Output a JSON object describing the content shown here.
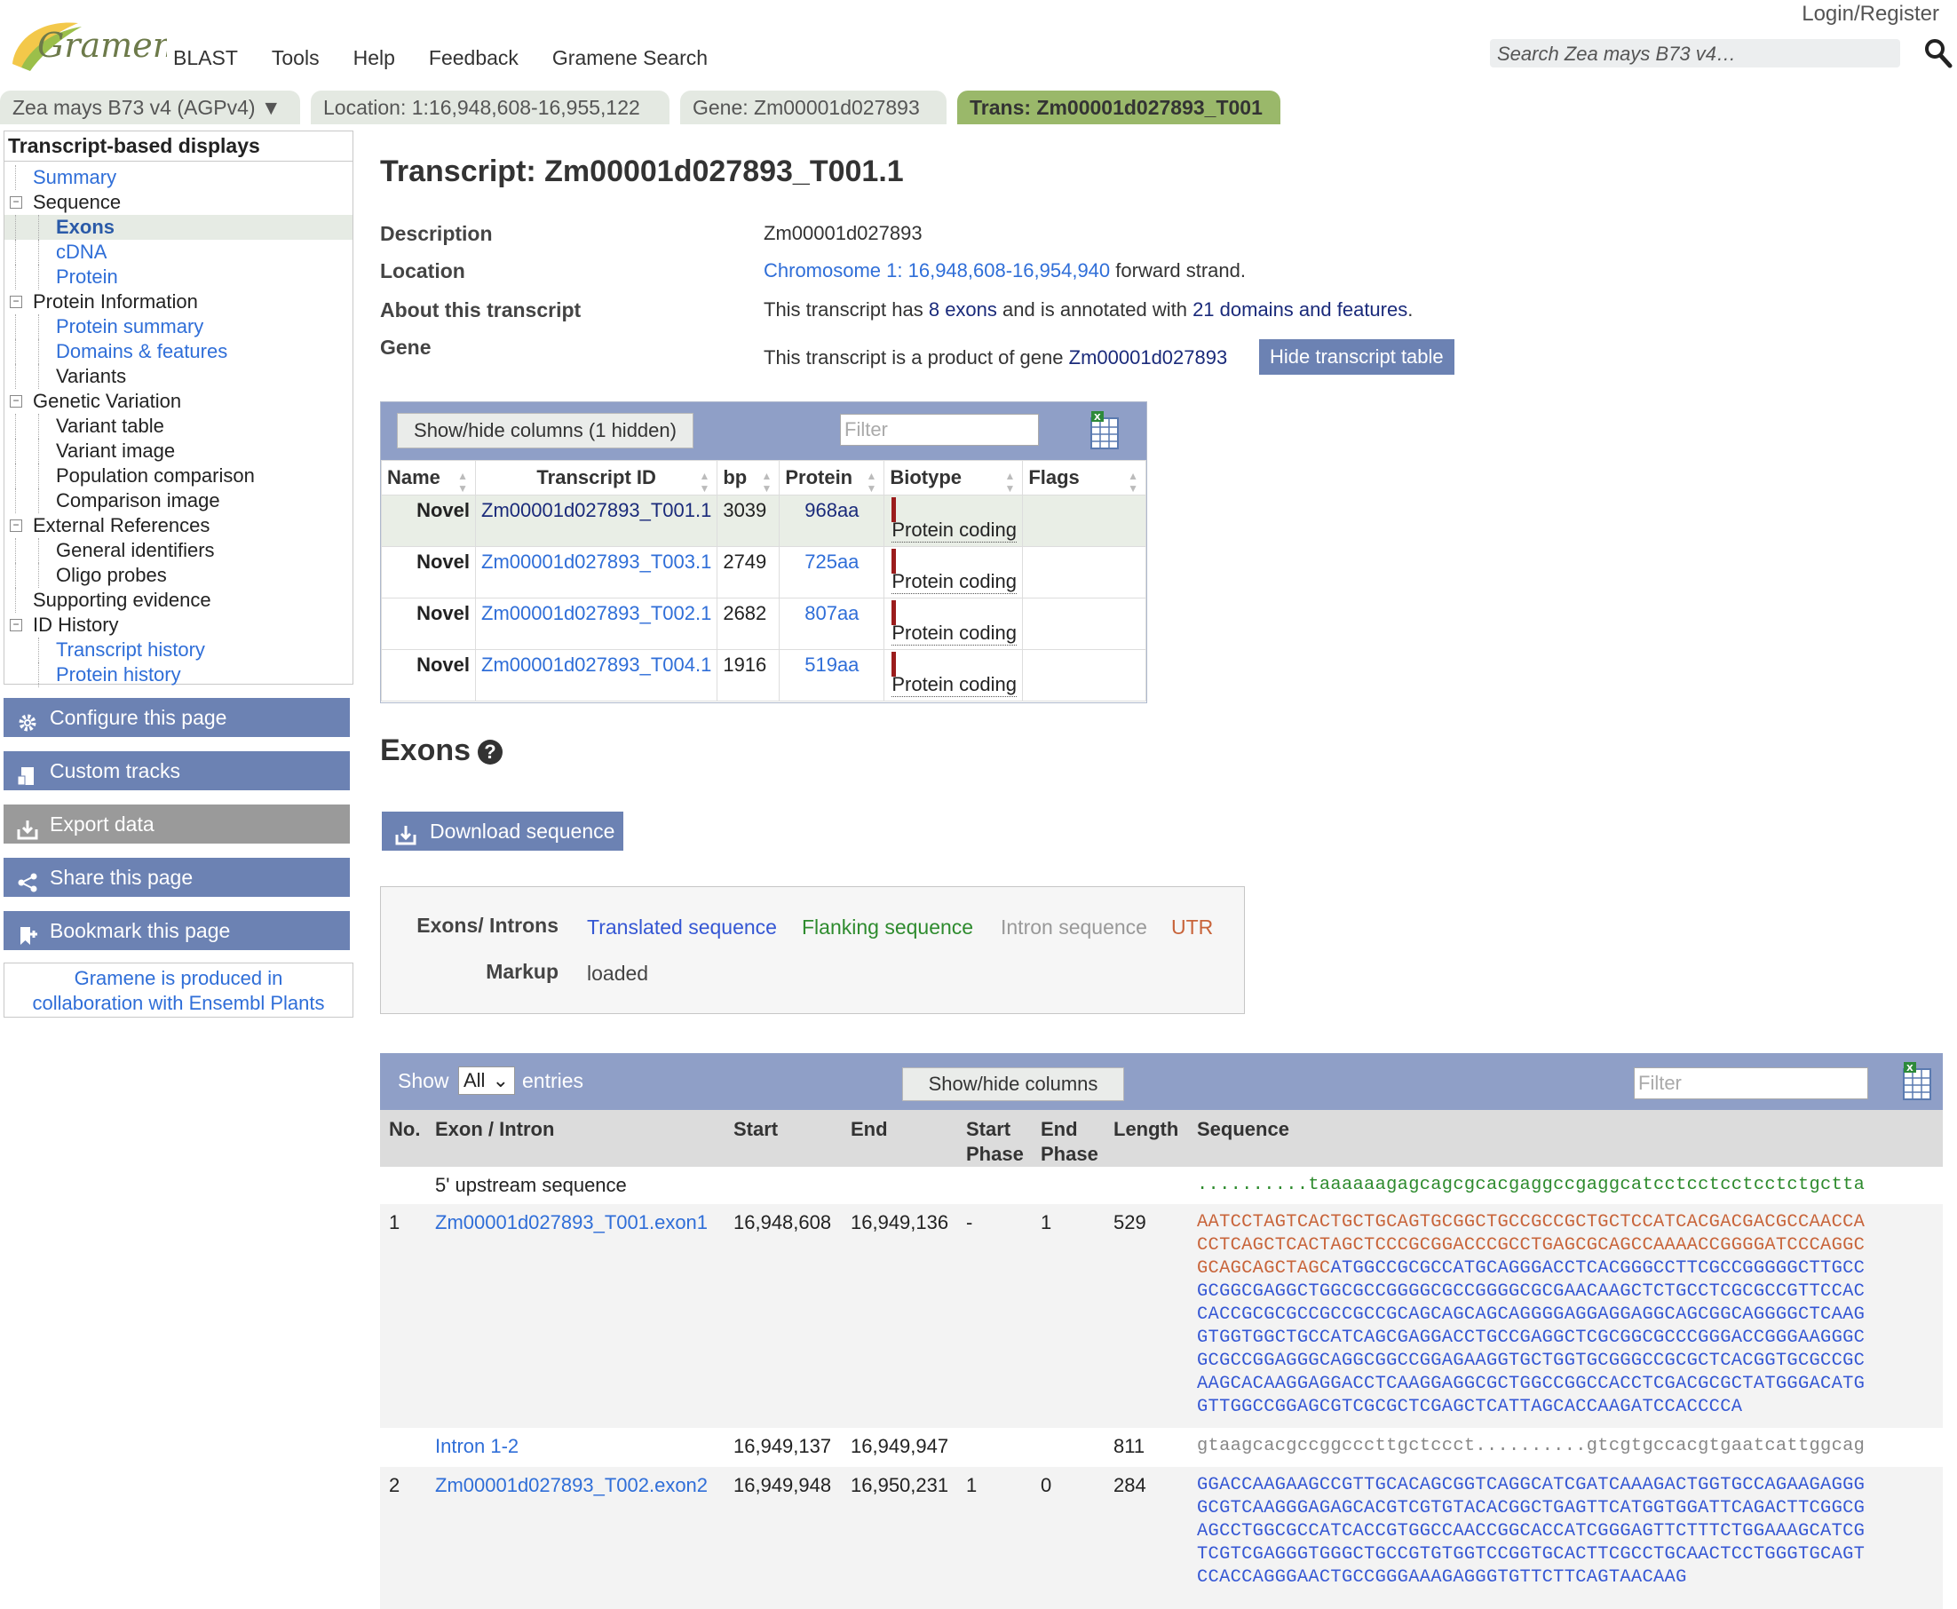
{
  "header": {
    "logo_text": "Gramene",
    "nav": [
      "BLAST",
      "Tools",
      "Help",
      "Feedback",
      "Gramene Search"
    ],
    "login": "Login/Register",
    "search_placeholder": "Search Zea mays B73 v4…"
  },
  "tabs": [
    {
      "label": "Zea mays B73 v4 (AGPv4) ▼",
      "active": false
    },
    {
      "label": "Location: 1:16,948,608-16,955,122",
      "active": false
    },
    {
      "label": "Gene: Zm00001d027893",
      "active": false
    },
    {
      "label": "Trans: Zm00001d027893_T001",
      "active": true
    }
  ],
  "sidebar": {
    "title": "Transcript-based displays",
    "items": [
      {
        "label": "Summary",
        "level": 1,
        "link": true
      },
      {
        "label": "Sequence",
        "level": 1,
        "toggle": true
      },
      {
        "label": "Exons",
        "level": 2,
        "link": true,
        "selected": true
      },
      {
        "label": "cDNA",
        "level": 2,
        "link": true
      },
      {
        "label": "Protein",
        "level": 2,
        "link": true
      },
      {
        "label": "Protein Information",
        "level": 1,
        "toggle": true
      },
      {
        "label": "Protein summary",
        "level": 2,
        "link": true
      },
      {
        "label": "Domains & features",
        "level": 2,
        "link": true
      },
      {
        "label": "Variants",
        "level": 2
      },
      {
        "label": "Genetic Variation",
        "level": 1,
        "toggle": true
      },
      {
        "label": "Variant table",
        "level": 2
      },
      {
        "label": "Variant image",
        "level": 2
      },
      {
        "label": "Population comparison",
        "level": 2
      },
      {
        "label": "Comparison image",
        "level": 2
      },
      {
        "label": "External References",
        "level": 1,
        "toggle": true
      },
      {
        "label": "General identifiers",
        "level": 2
      },
      {
        "label": "Oligo probes",
        "level": 2
      },
      {
        "label": "Supporting evidence",
        "level": 1
      },
      {
        "label": "ID History",
        "level": 1,
        "toggle": true
      },
      {
        "label": "Transcript history",
        "level": 2,
        "link": true
      },
      {
        "label": "Protein history",
        "level": 2,
        "link": true
      }
    ],
    "buttons": [
      "Configure this page",
      "Custom tracks",
      "Export data",
      "Share this page",
      "Bookmark this page"
    ],
    "collab_line1": "Gramene is produced in",
    "collab_line2": "collaboration with Ensembl Plants"
  },
  "main": {
    "title": "Transcript: Zm00001d027893_T001.1",
    "description_label": "Description",
    "description": "Zm00001d027893",
    "location_label": "Location",
    "location_link": "Chromosome 1: 16,948,608-16,954,940",
    "location_suffix": " forward strand.",
    "about_label": "About this transcript",
    "about_pre": "This transcript has ",
    "about_exons": "8 exons",
    "about_mid": " and is annotated with ",
    "about_domains": "21 domains and features",
    "about_post": ".",
    "gene_label": "Gene",
    "gene_pre": "This transcript is a product of gene ",
    "gene_link": "Zm00001d027893",
    "hide_table_button": "Hide transcript table"
  },
  "transcript_table": {
    "show_hide": "Show/hide columns (1 hidden)",
    "filter_placeholder": "Filter",
    "columns": [
      "Name",
      "Transcript ID",
      "bp",
      "Protein",
      "Biotype",
      "Flags"
    ],
    "rows": [
      {
        "name": "Novel",
        "id": "Zm00001d027893_T001.1",
        "bp": "3039",
        "protein": "968aa",
        "biotype": "Protein coding",
        "flags": ""
      },
      {
        "name": "Novel",
        "id": "Zm00001d027893_T003.1",
        "bp": "2749",
        "protein": "725aa",
        "biotype": "Protein coding",
        "flags": ""
      },
      {
        "name": "Novel",
        "id": "Zm00001d027893_T002.1",
        "bp": "2682",
        "protein": "807aa",
        "biotype": "Protein coding",
        "flags": ""
      },
      {
        "name": "Novel",
        "id": "Zm00001d027893_T004.1",
        "bp": "1916",
        "protein": "519aa",
        "biotype": "Protein coding",
        "flags": ""
      }
    ]
  },
  "exons_section": {
    "title": "Exons",
    "download_button": "Download sequence",
    "legend": {
      "label": "Exons/ Introns",
      "items": [
        {
          "text": "Translated sequence",
          "color": "#3557d4"
        },
        {
          "text": "Flanking sequence",
          "color": "#2e8b2e"
        },
        {
          "text": "Intron sequence",
          "color": "#999999"
        },
        {
          "text": "UTR",
          "color": "#c8643a"
        }
      ],
      "markup_label": "Markup",
      "markup_value": "loaded"
    }
  },
  "exon_table": {
    "show": "Show",
    "select_value": "All",
    "entries": "entries",
    "show_hide": "Show/hide columns",
    "filter_placeholder": "Filter",
    "columns": {
      "no": "No.",
      "exon": "Exon / Intron",
      "start": "Start",
      "end": "End",
      "start_phase_1": "Start",
      "start_phase_2": "Phase",
      "end_phase_1": "End",
      "end_phase_2": "Phase",
      "length": "Length",
      "sequence": "Sequence"
    },
    "upstream": {
      "label": "5' upstream sequence",
      "seq": "..........taaaaaagagcagcgcacgaggccgaggcatcctcctcctcctctgctta"
    },
    "exon1": {
      "no": "1",
      "id": "Zm00001d027893_T001.exon1",
      "start": "16,948,608",
      "end": "16,949,136",
      "start_phase": "-",
      "end_phase": "1",
      "length": "529",
      "utr_lines": [
        "AATCCTAGTCACTGCTGCAGTGCGGCTGCCGCCGCTGCTCCATCACGACGACGCCAACCA",
        "CCTCAGCTCACTAGCTCCCGCGGACCCGCCTGAGCGCAGCCAAAACCGGGGATCCCAGGC"
      ],
      "mixed_utr": "GCAGCAGCTAGC",
      "mixed_trans": "ATGGCCGCGCCATGCAGGGACCTCACGGGCCTTCGCCGGGGGCTTGCC",
      "trans_lines": [
        "GCGGCGAGGCTGGCGCCGGGGCGCCGGGGCGCGAACAAGCTCTGCCTCGCGCCGTTCCAC",
        "CACCGCGCGCCGCCGCCGCAGCAGCAGCAGGGGAGGAGGAGGCAGCGGCAGGGGCTCAAG",
        "GTGGTGGCTGCCATCAGCGAGGACCTGCCGAGGCTCGCGGCGCCCGGGACCGGGAAGGGC",
        "GCGCCGGAGGGCAGGCGGCCGGAGAAGGTGCTGGTGCGGGCCGCGCTCACGGTGCGCCGC",
        "AAGCACAAGGAGGACCTCAAGGAGGCGCTGGCCGGCCACCTCGACGCGCTATGGGACATG",
        "GTTGGCCGGAGCGTCGCGCTCGAGCTCATTAGCACCAAGATCCACCCCA"
      ]
    },
    "intron": {
      "id": "Intron 1-2",
      "start": "16,949,137",
      "end": "16,949,947",
      "length": "811",
      "seq": "gtaagcacgccggcccttgctccct..........gtcgtgccacgtgaatcattggcag"
    },
    "exon2": {
      "no": "2",
      "id": "Zm00001d027893_T002.exon2",
      "start": "16,949,948",
      "end": "16,950,231",
      "start_phase": "1",
      "end_phase": "0",
      "length": "284",
      "trans_lines": [
        "GGACCAAGAAGCCGTTGCACAGCGGTCAGGCATCGATCAAAGACTGGTGCCAGAAGAGGG",
        "GCGTCAAGGGAGAGCACGTCGTGTACACGGCTGAGTTCATGGTGGATTCAGACTTCGGCG",
        "AGCCTGGCGCCATCACCGTGGCCAACCGGCACCATCGGGAGTTCTTTCTGGAAAGCATCG",
        "TCGTCGAGGGTGGGCTGCCGTGTGGTCCGGTGCACTTCGCCTGCAACTCCTGGGTGCAGT",
        "CCACCAGGGAACTGCCGGGAAAGAGGGTGTTCTTCAGTAACAAG"
      ]
    }
  }
}
